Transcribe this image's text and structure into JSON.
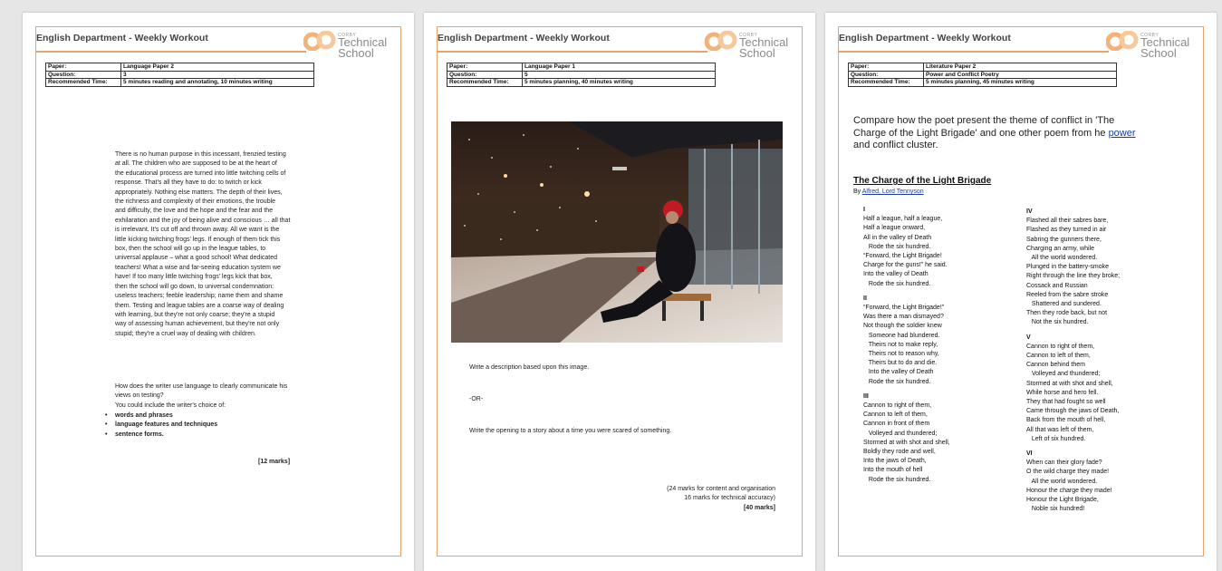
{
  "header": {
    "title": "English Department - Weekly Workout",
    "logo_small": "CORBY",
    "logo_line1": "Technical",
    "logo_line2": "School"
  },
  "pages": [
    {
      "meta": {
        "paper_label": "Paper:",
        "paper": "Language Paper 2",
        "question_label": "Question:",
        "question": "3",
        "time_label": "Recommended Time:",
        "time": "5 minutes reading and annotating, 10 minutes writing"
      },
      "extract": [
        "There is no human purpose in this incessant, frenzied testing",
        "at all.  The children who are supposed to be at the heart of",
        "the educational process are turned into little twitching cells of",
        "response. That's all they have to do: to twitch or kick",
        "appropriately.  Nothing else matters.  The depth of their lives,",
        "the richness and complexity of their emotions, the trouble",
        "and difficulty, the love and the hope and the fear and the",
        "exhilaration and the joy of being alive and conscious … all that",
        "is irrelevant.  It's cut off and thrown away.  All we want is the",
        "little kicking twitching frogs' legs.  If enough of them tick this",
        "box, then the school will go up in the league tables, to",
        "universal applause – what a good school! What dedicated",
        "teachers!  What a wise and far-seeing education system we",
        "have!  If too many little twitching frogs' legs kick that box,",
        "then the school will go down, to universal condemnation:",
        "useless teachers; feeble leadership; name them and shame",
        "them.  Testing and league tables are a coarse way of dealing",
        "with learning, but they're not only coarse; they're a stupid",
        "way of assessing human achievement, but they're not only",
        "stupid; they're a cruel way of dealing with children."
      ],
      "question_text": [
        "How does the writer use language to clearly communicate his",
        "views on testing?",
        "You could include the writer's choice of:"
      ],
      "bullets": [
        "words and phrases",
        "language features and techniques",
        "sentence forms."
      ],
      "marks": "[12 marks]"
    },
    {
      "meta": {
        "paper_label": "Paper:",
        "paper": "Language Paper 1",
        "question_label": "Question:",
        "question": "5",
        "time_label": "Recommended Time:",
        "time": "5 minutes planning, 40 minutes writing"
      },
      "task1": "Write a description based upon this image.",
      "or": "-OR-",
      "task2": "Write the opening to a story about a time you were scared of something.",
      "marks1": "(24 marks for content and organisation",
      "marks2": "16 marks for technical accuracy)",
      "marks3": "[40 marks]"
    },
    {
      "meta": {
        "paper_label": "Paper:",
        "paper": "Literature Paper 2",
        "question_label": "Question:",
        "question": "Power and Conflict Poetry",
        "time_label": "Recommended Time:",
        "time": "5 minutes planning, 45 minutes writing"
      },
      "prompt_pre": "Compare how the poet present the theme of conflict in 'The Charge of the Light Brigade' and one other poem from he ",
      "prompt_link": "power",
      "prompt_post": " and conflict cluster.",
      "poem_title": "The Charge of the Light Brigade",
      "by": "By ",
      "author": "Alfred, Lord Tennyson",
      "stanzas_left": [
        {
          "n": "I",
          "text": "Half a league, half a league,\nHalf a league onward,\nAll in the valley of Death\n   Rode the six hundred.\n“Forward, the Light Brigade!\nCharge for the guns!” he said.\nInto the valley of Death\n   Rode the six hundred."
        },
        {
          "n": "II",
          "text": "“Forward, the Light Brigade!”\nWas there a man dismayed?\nNot though the soldier knew\n   Someone had blundered.\n   Theirs not to make reply,\n   Theirs not to reason why,\n   Theirs but to do and die.\n   Into the valley of Death\n   Rode the six hundred."
        },
        {
          "n": "III",
          "text": "Cannon to right of them,\nCannon to left of them,\nCannon in front of them\n   Volleyed and thundered;\nStormed at with shot and shell,\nBoldly they rode and well,\nInto the jaws of Death,\nInto the mouth of hell\n   Rode the six hundred."
        }
      ],
      "stanzas_right": [
        {
          "n": "IV",
          "text": "Flashed all their sabres bare,\nFlashed as they turned in air\nSabring the gunners there,\nCharging an army, while\n   All the world wondered.\nPlunged in the battery-smoke\nRight through the line they broke;\nCossack and Russian\nReeled from the sabre stroke\n   Shattered and sundered.\nThen they rode back, but not\n   Not the six hundred."
        },
        {
          "n": "V",
          "text": "Cannon to right of them,\nCannon to left of them,\nCannon behind them\n   Volleyed and thundered;\nStormed at with shot and shell,\nWhile horse and hero fell.\nThey that had fought so well\nCame through the jaws of Death,\nBack from the mouth of hell,\nAll that was left of them,\n   Left of six hundred."
        },
        {
          "n": "VI",
          "text": "When can their glory fade?\nO the wild charge they made!\n   All the world wondered.\nHonour the charge they made!\nHonour the Light Brigade,\n   Noble six hundred!"
        }
      ]
    }
  ]
}
